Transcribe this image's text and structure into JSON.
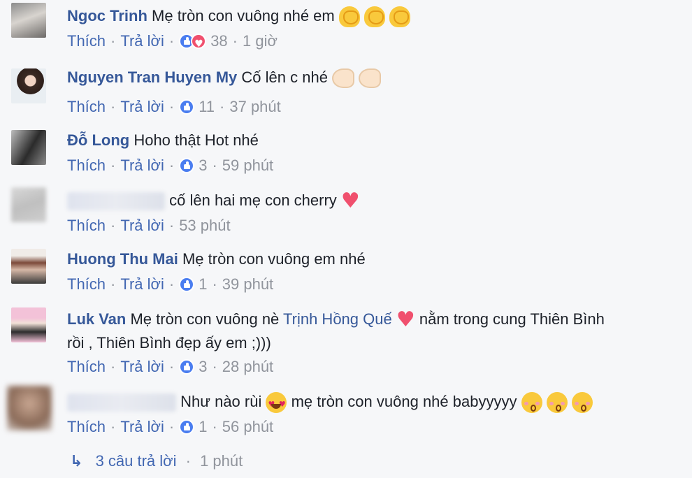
{
  "actions": {
    "like": "Thích",
    "reply": "Trả lời"
  },
  "comments": [
    {
      "author": "Ngoc Trinh",
      "text": "Mẹ tròn con vuông nhé em",
      "reactions": "38",
      "time": "1 giờ"
    },
    {
      "author": "Nguyen Tran Huyen My",
      "text": "Cố lên c nhé",
      "reactions": "11",
      "time": "37 phút"
    },
    {
      "author": "Đỗ Long",
      "text": "Hoho thật Hot nhé",
      "reactions": "3",
      "time": "59 phút"
    },
    {
      "author": "",
      "text": "cố lên hai mẹ con cherry",
      "reactions": "",
      "time": "53 phút"
    },
    {
      "author": "Huong Thu Mai",
      "text": "Mẹ tròn con vuông em nhé",
      "reactions": "1",
      "time": "39 phút"
    },
    {
      "author": "Luk Van",
      "text": "Mẹ tròn con vuông nè",
      "tag": "Trịnh Hồng Quế",
      "text2": "nằm trong cung Thiên Bình",
      "text3": "rồi , Thiên Bình đẹp ấy em ;)))",
      "reactions": "3",
      "time": "28 phút"
    },
    {
      "author": "",
      "text": "Như nào rùi",
      "text2": "mẹ tròn con vuông nhé babyyyyy",
      "reactions": "1",
      "time": "56 phút"
    }
  ],
  "replies": {
    "label": "3 câu trả lời",
    "time": "1 phút"
  },
  "colors": {
    "author": "#365899",
    "link": "#4267b2",
    "meta": "#90949c",
    "background": "#f6f7f9"
  }
}
